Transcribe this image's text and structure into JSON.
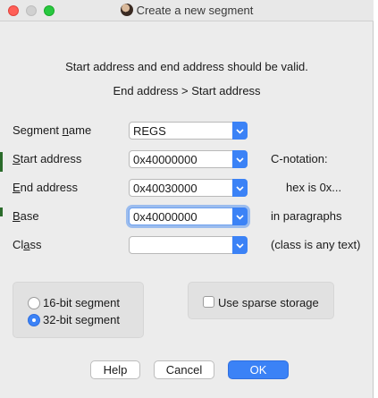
{
  "window": {
    "title": "Create a new segment"
  },
  "messages": {
    "line1": "Start address and end address should be valid.",
    "line2": "End address > Start address"
  },
  "fields": {
    "segment_name": {
      "label_pre": "Segment ",
      "label_mn": "n",
      "label_post": "ame",
      "value": "REGS"
    },
    "start_address": {
      "label_mn": "S",
      "label_post": "tart address",
      "value": "0x40000000"
    },
    "end_address": {
      "label_mn": "E",
      "label_post": "nd address",
      "value": "0x40030000"
    },
    "base": {
      "label_mn": "B",
      "label_post": "ase",
      "value": "0x40000000"
    },
    "class": {
      "label_pre": "Cl",
      "label_mn": "a",
      "label_post": "ss",
      "value": ""
    }
  },
  "hints": {
    "c_notation": "C-notation:",
    "hex": "hex is 0x...",
    "paragraphs": "in paragraphs",
    "class_any": "(class is any text)"
  },
  "bitness": {
    "options": [
      "16-bit segment",
      "32-bit segment"
    ],
    "selected": "32-bit segment"
  },
  "sparse": {
    "label": "Use sparse storage",
    "checked": false
  },
  "buttons": {
    "help": "Help",
    "cancel": "Cancel",
    "ok": "OK"
  },
  "colors": {
    "accent": "#3b82f6",
    "close": "#ff5f57",
    "maximize": "#28c840"
  }
}
